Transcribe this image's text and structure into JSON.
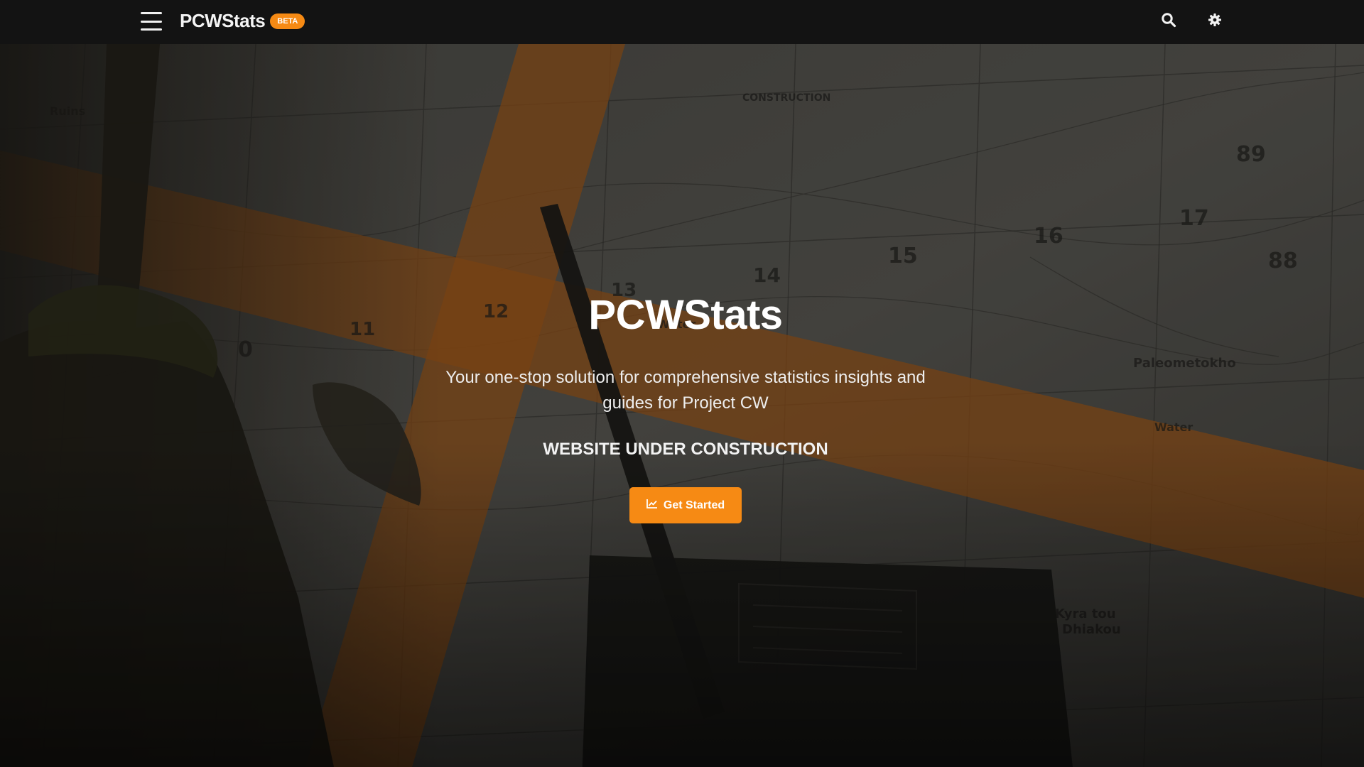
{
  "navbar": {
    "brand": "PCWStats",
    "badge": "BETA",
    "icons": [
      "menu-icon",
      "search-icon",
      "gear-icon"
    ]
  },
  "hero": {
    "title": "PCWStats",
    "subtitle": "Your one-stop solution for comprehensive statistics insights and guides for Project CW",
    "notice": "WEBSITE UNDER CONSTRUCTION",
    "cta_label": "Get Started",
    "cta_icon": "chart-line-icon"
  },
  "colors": {
    "accent": "#f68a14",
    "navbar_bg": "#131313",
    "text": "#ffffff"
  }
}
